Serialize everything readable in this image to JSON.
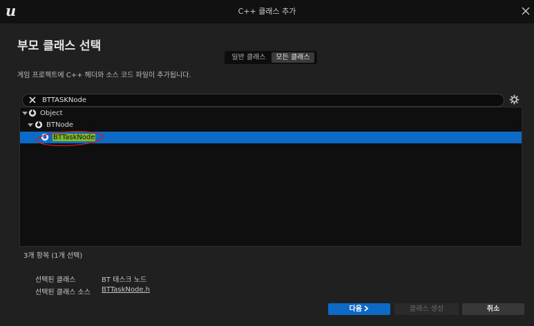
{
  "window": {
    "title": "C++ 클래스 추가",
    "logo_letter": "u"
  },
  "heading": "부모 클래스 선택",
  "class_filter": {
    "options": [
      "일반 클래스",
      "모든 클래스"
    ],
    "selected": "모든 클래스"
  },
  "description": "게임 프로젝트에 C++ 헤더와 소스 코드 파일이 추가됩니다.",
  "search": {
    "value": "BTTASKNode"
  },
  "tree": [
    {
      "label": "Object",
      "expanded": true,
      "selected": false
    },
    {
      "label": "BTNode",
      "expanded": true,
      "selected": false
    },
    {
      "label": "BTTaskNode",
      "expanded": false,
      "selected": true
    }
  ],
  "item_count": "3개 항목 (1개 선택)",
  "info": {
    "selected_class_label": "선택된 클래스",
    "selected_class_value": "BT 태스크 노드",
    "selected_source_label": "선택된 클래스 소스",
    "selected_source_value": "BTTaskNode.h"
  },
  "buttons": {
    "next": "다음",
    "create": "클래스 생성",
    "cancel": "취소"
  },
  "colors": {
    "accent": "#0e6ac7",
    "highlight": "#7fb828",
    "annotation": "#d21a1a"
  },
  "icons": {
    "close": "close-icon",
    "clear": "clear-search-icon",
    "settings": "gear-icon",
    "class": "class-icon",
    "expand": "triangle-down-icon",
    "next": "chevron-right-icon"
  }
}
